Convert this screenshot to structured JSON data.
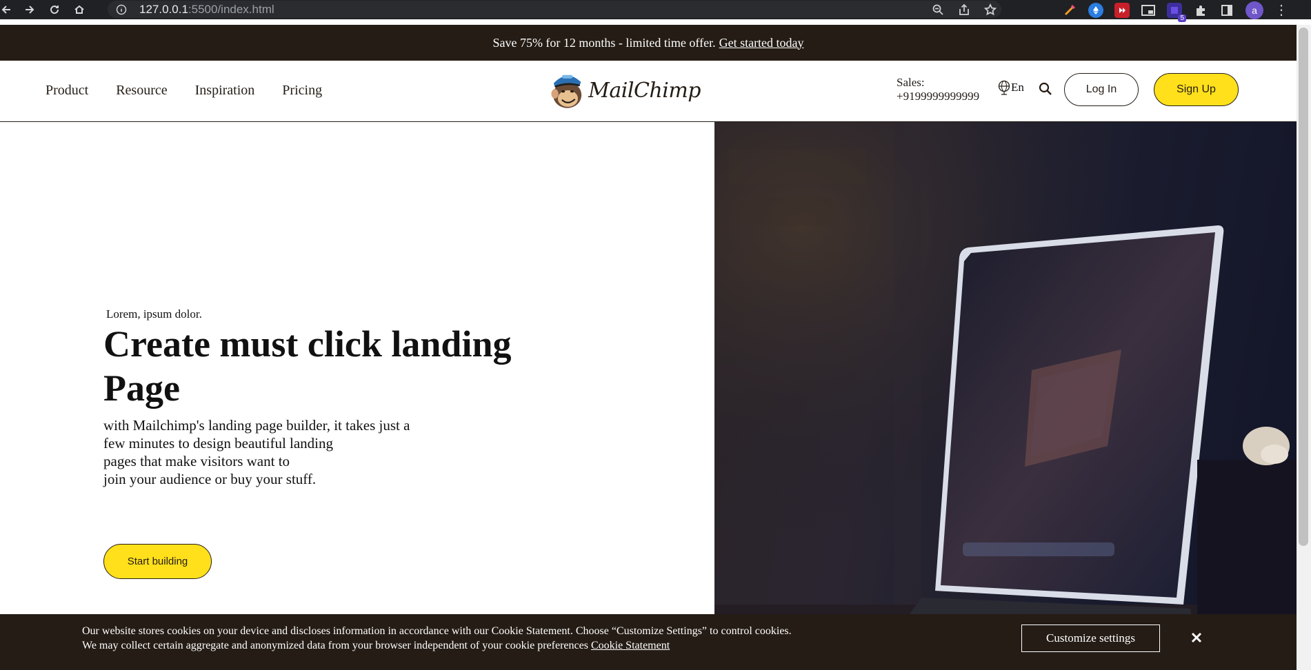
{
  "browser": {
    "url_host": "127.0.0.1",
    "url_path": ":5500/index.html",
    "extension_badge": "5",
    "profile_initial": "a"
  },
  "promo": {
    "text": "Save 75% for 12 months - limited time offer.",
    "link": "Get started today"
  },
  "nav": {
    "items": [
      "Product",
      "Resource",
      "Inspiration",
      "Pricing"
    ]
  },
  "logo": {
    "wordmark": "MailChimp"
  },
  "sales": {
    "label": "Sales:",
    "phone": "+9199999999999"
  },
  "language": "En",
  "buttons": {
    "login": "Log In",
    "signup": "Sign Up",
    "start": "Start building"
  },
  "hero": {
    "eyebrow": "Lorem, ipsum dolor.",
    "headline": "Create must click landing Page",
    "sub_lines": [
      "with Mailchimp's landing page builder, it takes just a",
      "few minutes to design beautiful landing",
      "pages that make visitors want to",
      "join your audience or buy your stuff."
    ]
  },
  "cookie": {
    "line1": "Our website stores cookies on your device and discloses information in accordance with our Cookie Statement. Choose “Customize Settings” to control cookies.",
    "line2": "We may collect certain aggregate and anonymized data from your browser independent of your cookie preferences",
    "link": "Cookie Statement",
    "customize": "Customize settings"
  },
  "colors": {
    "brand_dark": "#241c15",
    "brand_yellow": "#ffe01b"
  }
}
